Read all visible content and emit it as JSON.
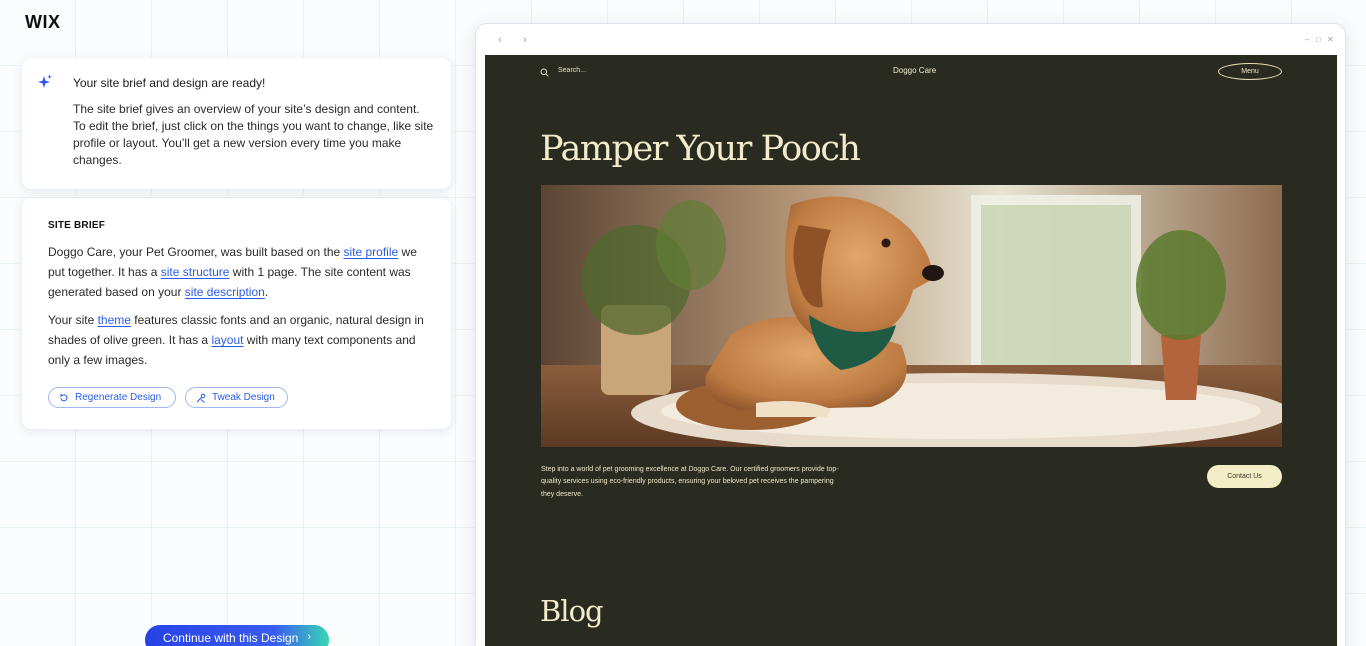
{
  "app": {
    "logo": "WIX"
  },
  "intro": {
    "title": "Your site brief and design are ready!",
    "body": "The site brief gives an overview of your site’s design and content. To edit the brief, just click on the things you want to change, like site profile or layout. You’ll get a new version every time you make changes."
  },
  "brief": {
    "heading": "SITE BRIEF",
    "p1_a": "Doggo Care, your Pet Groomer, was built based on the ",
    "link_profile": "site profile",
    "p1_b": " we put together. It has a ",
    "link_structure": "site structure",
    "p1_c": " with 1 page. The site content was generated based on your ",
    "link_description": "site description",
    "p1_d": ".",
    "p2_a": "Your site ",
    "link_theme": "theme",
    "p2_b": " features classic fonts and an organic, natural design in shades of olive green. It has a ",
    "link_layout": "layout",
    "p2_c": " with many text components and only a few images.",
    "regenerate_label": "Regenerate Design",
    "tweak_label": "Tweak Design"
  },
  "continue_label": "Continue with this Design",
  "browser": {
    "back": "‹",
    "forward": "›",
    "min": "–",
    "max": "□",
    "close": "✕"
  },
  "site": {
    "search": "Search...",
    "brand": "Doggo Care",
    "menu": "Menu",
    "hero": "Pamper Your Pooch",
    "intro": "Step into a world of pet grooming excellence at Doggo Care. Our certified groomers provide top-quality services using eco-friendly products, ensuring your beloved pet receives the pampering they deserve.",
    "contact": "Contact Us",
    "blog": "Blog"
  },
  "colors": {
    "accent": "#2b5ce7",
    "site_bg": "#2a2b20",
    "site_text": "#f3ebcc",
    "bandana": "#1f5a45"
  }
}
